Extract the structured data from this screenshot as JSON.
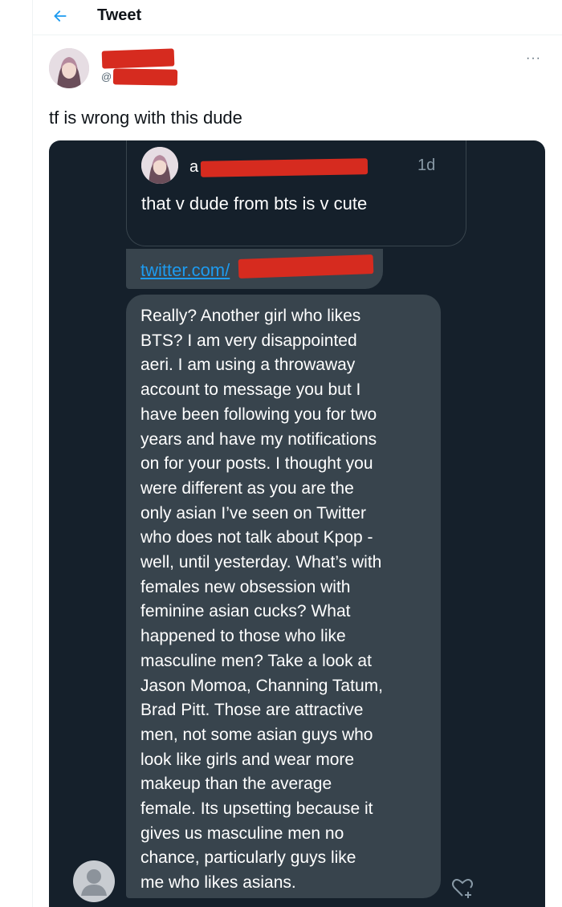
{
  "header": {
    "title": "Tweet",
    "back_icon": "arrow-left-icon"
  },
  "author": {
    "handle_prefix": "@"
  },
  "tweet": {
    "text": "tf is wrong with this dude",
    "more_icon": "ellipsis-icon",
    "more_label": "···"
  },
  "screenshot": {
    "quoted_tweet": {
      "name_prefix": "a",
      "time": "1d",
      "text": "that v dude from bts is v cute"
    },
    "link": {
      "text": "twitter.com/"
    },
    "message": {
      "text": "Really? Another girl who likes\nBTS? I am very disappointed\naeri. I am using a throwaway\naccount to message you but I\nhave been following you for two\nyears and have my notifications\non for your posts. I thought you\nwere different as you are the\nonly asian I’ve seen on Twitter\nwho does not talk about Kpop -\nwell, until yesterday. What’s with\nfemales new obsession with\nfeminine asian cucks? What\nhappened to those who like\nmasculine men? Take a look at\nJason Momoa, Channing Tatum,\nBrad Pitt. Those are attractive\nmen, not some asian guys who\nlook like girls and wear more\nmakeup than the average\nfemale. Its upsetting because it\ngives us masculine men no\nchance, particularly guys like\nme who likes asians."
    },
    "reaction_icon": "heart-plus-icon",
    "sender_avatar_icon": "default-user-icon"
  },
  "colors": {
    "accent": "#1d9bf0",
    "redaction": "#d62b1f",
    "dm_bg": "#15202b",
    "bubble": "#38444d"
  }
}
